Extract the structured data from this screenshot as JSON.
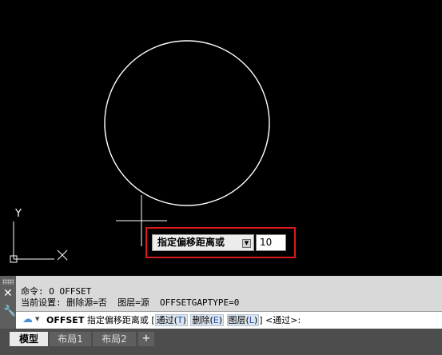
{
  "canvas": {
    "ucs_y_label": "Y",
    "ucs_x_label": "X"
  },
  "dynamic_input": {
    "prompt": "指定偏移距离或",
    "value": "10",
    "highlight_color": "#d91a1a"
  },
  "command_history": [
    "命令: O OFFSET",
    "当前设置: 删除源=否  图层=源  OFFSETGAPTYPE=0"
  ],
  "command_line": {
    "command": "OFFSET",
    "prompt": "指定偏移距离或",
    "open_bracket": "[",
    "options": [
      {
        "label": "通过",
        "key": "T"
      },
      {
        "label": "删除",
        "key": "E"
      },
      {
        "label": "图层",
        "key": "L"
      }
    ],
    "close_bracket": "]",
    "default": "<通过>:"
  },
  "tabs": [
    {
      "label": "模型",
      "active": true
    },
    {
      "label": "布局1",
      "active": false
    },
    {
      "label": "布局2",
      "active": false
    }
  ],
  "add_tab_label": "+"
}
